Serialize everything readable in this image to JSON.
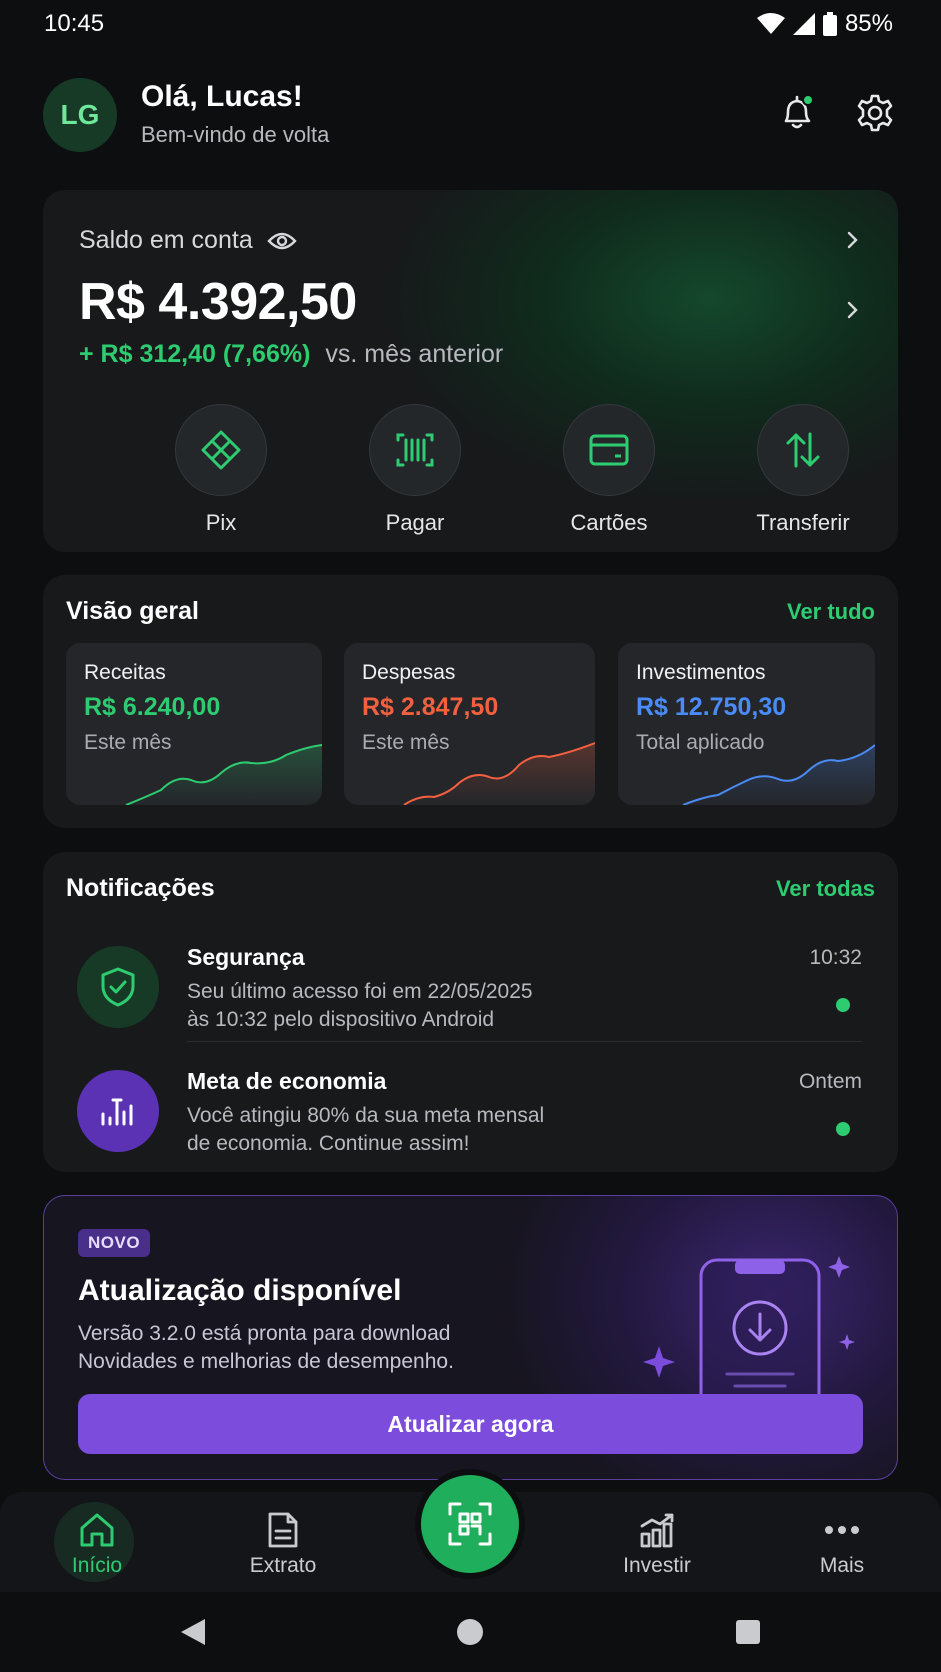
{
  "status_bar": {
    "time": "10:45",
    "battery": "85%"
  },
  "header": {
    "avatar_initials": "LG",
    "greeting": "Olá, Lucas!",
    "subtitle": "Bem-vindo de volta"
  },
  "balance": {
    "label": "Saldo em conta",
    "value": "R$ 4.392,50",
    "change": "+ R$ 312,40 (7,66%)",
    "comparison": "vs. mês anterior",
    "actions": [
      {
        "label": "Pix",
        "icon": "pix-icon"
      },
      {
        "label": "Pagar",
        "icon": "barcode-icon"
      },
      {
        "label": "Cartões",
        "icon": "card-icon"
      },
      {
        "label": "Transferir",
        "icon": "transfer-arrows-icon"
      }
    ]
  },
  "overview": {
    "title": "Visão geral",
    "link": "Ver tudo",
    "cards": [
      {
        "title": "Receitas",
        "value": "R$ 6.240,00",
        "subtitle": "Este mês",
        "color": "#2ecc71"
      },
      {
        "title": "Despesas",
        "value": "R$ 2.847,50",
        "subtitle": "Este mês",
        "color": "#f2603f"
      },
      {
        "title": "Investimentos",
        "value": "R$ 12.750,30",
        "subtitle": "Total aplicado",
        "color": "#4a8cf7"
      }
    ]
  },
  "notifications": {
    "title": "Notificações",
    "link": "Ver todas",
    "items": [
      {
        "title": "Segurança",
        "body_line1": "Seu último acesso foi em 22/05/2025",
        "body_line2": "às 10:32 pelo dispositivo Android",
        "time": "10:32",
        "icon": "shield-check-icon"
      },
      {
        "title": "Meta de economia",
        "body_line1": "Você atingiu 80% da sua meta mensal",
        "body_line2": "de economia. Continue assim!",
        "time": "Ontem",
        "icon": "chart-bars-icon"
      }
    ]
  },
  "update": {
    "badge": "NOVO",
    "title": "Atualização disponível",
    "desc_line1": "Versão 3.2.0 está pronta para download",
    "desc_line2": "Novidades e melhorias de desempenho.",
    "button": "Atualizar agora"
  },
  "bottom_nav": {
    "items": [
      {
        "label": "Início",
        "icon": "home-icon",
        "active": true
      },
      {
        "label": "Extrato",
        "icon": "document-icon"
      },
      {
        "label": "Investir",
        "icon": "growth-chart-icon"
      },
      {
        "label": "Mais",
        "icon": "more-dots-icon"
      }
    ],
    "center_icon": "qr-scan-icon"
  },
  "colors": {
    "accent": "#2ecc71",
    "income": "#2ecc71",
    "expense": "#f2603f",
    "investment": "#4a8cf7",
    "update_purple": "#7c4ddc"
  }
}
